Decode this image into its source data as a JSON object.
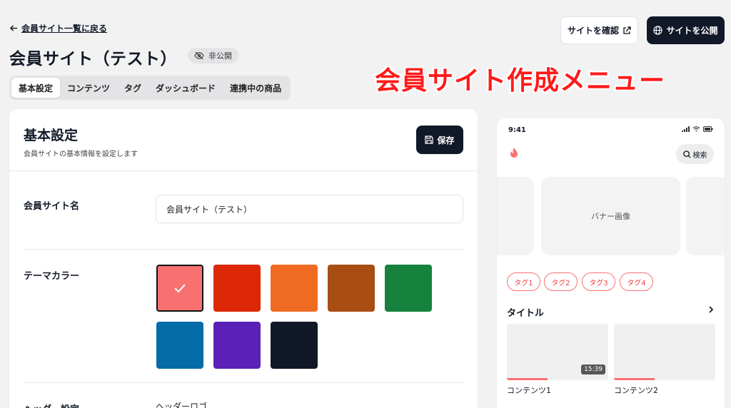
{
  "back_link": "会員サイト一覧に戻る",
  "page_title": "会員サイト（テスト）",
  "visibility_badge": "非公開",
  "tabs": [
    {
      "label": "基本設定",
      "active": true
    },
    {
      "label": "コンテンツ",
      "active": false
    },
    {
      "label": "タグ",
      "active": false
    },
    {
      "label": "ダッシュボード",
      "active": false
    },
    {
      "label": "連携中の商品",
      "active": false
    }
  ],
  "header_actions": {
    "confirm_label": "サイトを確認",
    "publish_label": "サイトを公開"
  },
  "overlay_caption": "会員サイト作成メニュー",
  "settings": {
    "title": "基本設定",
    "description": "会員サイトの基本情報を設定します",
    "save_label": "保存",
    "site_name_label": "会員サイト名",
    "site_name_value": "会員サイト（テスト）",
    "theme_color_label": "テーマカラー",
    "theme_colors": [
      "#f87171",
      "#dc2807",
      "#f06b22",
      "#a84e12",
      "#16813d",
      "#046ca6",
      "#5b21b6",
      "#111827"
    ],
    "selected_color_index": 0,
    "header_label": "ヘッダー設定",
    "header_logo_label": "ヘッダーロゴ"
  },
  "preview": {
    "time": "9:41",
    "search_label": "検索",
    "banner_label": "バナー画像",
    "tags": [
      "タグ1",
      "タグ2",
      "タグ3",
      "タグ4"
    ],
    "section_title": "タイトル",
    "contents": [
      {
        "label": "コンテンツ1",
        "duration": "15:39",
        "progress": 0.4
      },
      {
        "label": "コンテンツ2",
        "duration": "",
        "progress": 0.4
      }
    ]
  },
  "colors": {
    "accent": "#f87171",
    "dark": "#111827",
    "caption": "#ff1a1a"
  }
}
